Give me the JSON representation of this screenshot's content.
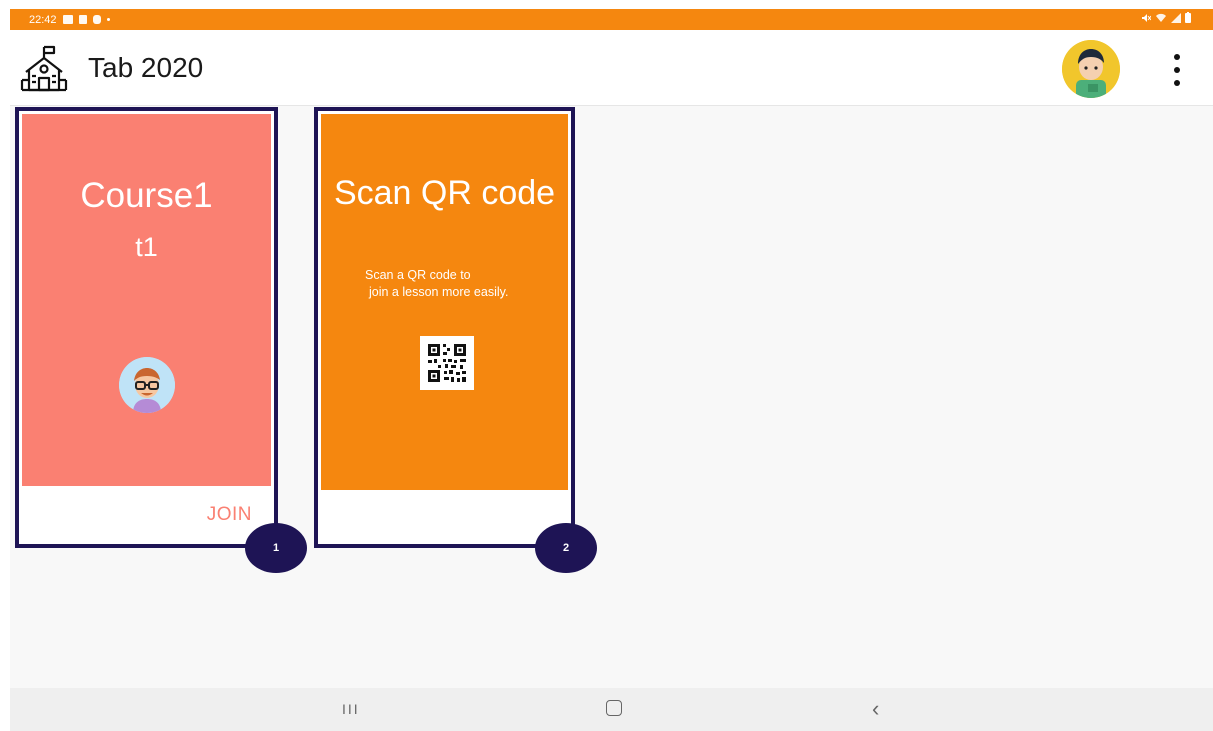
{
  "status_bar": {
    "time": "22:42",
    "background": "#f5870f"
  },
  "app_bar": {
    "title": "Tab 2020",
    "logo_icon": "school-building-icon",
    "menu_icon": "more-vert-icon"
  },
  "cards": [
    {
      "title": "Course1",
      "subtitle": "t1",
      "action_label": "JOIN",
      "badge": "1",
      "color": "#fa8072"
    },
    {
      "title": "Scan QR code",
      "description_line1": "Scan a QR code to",
      "description_line2": "join a lesson more easily.",
      "badge": "2",
      "color": "#f5870f"
    }
  ],
  "nav_bar": {
    "recent_icon": "recent-apps-icon",
    "home_icon": "home-icon",
    "back_icon": "back-icon",
    "recent_glyph": "III",
    "back_glyph": "‹"
  },
  "colors": {
    "accent": "#f5870f",
    "badge": "#1e1455",
    "card_border": "#1e1455"
  }
}
